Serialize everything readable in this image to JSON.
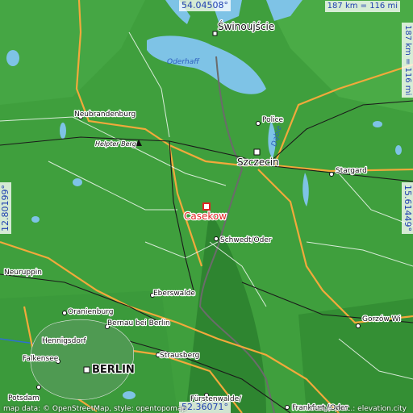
{
  "coordinates": {
    "lat_top": "54.04508°",
    "lat_bottom": "52.36071°",
    "lon_left": "12.80199°",
    "lon_right": "15.61449°"
  },
  "scale": {
    "horizontal": "187 km = 116 mi",
    "vertical": "187 km = 116 mi"
  },
  "target_place": "Casekow",
  "places": {
    "swinoujscie": "Świnoujście",
    "police": "Police",
    "szczecin": "Szczecin",
    "stargard": "Stargard",
    "neubrandenburg": "Neubrandenburg",
    "helpter_berg": "Helpter Berg",
    "schwedt": "Schwedt/Oder",
    "neuruppin": "Neuruppin",
    "eberswalde": "Eberswalde",
    "oranienburg": "Oranienburg",
    "bernau": "Bernau bei Berlin",
    "hennigsdorf": "Hennigsdorf",
    "falkensee": "Falkensee",
    "berlin": "BERLIN",
    "strausberg": "Strausberg",
    "potsdam": "Potsdam",
    "gorzow": "Gorzów Wi",
    "furstenwalde": "Fürstenwalde/",
    "frankfurt": "Frankfurt (Oder"
  },
  "water_labels": {
    "oderhaff": "Oderhaff",
    "dabie": "Dąbie"
  },
  "footer": {
    "left": "map data: © OpenStreetMap, style: opentopomap",
    "right": "image proc.: elevation.city"
  },
  "colors": {
    "land": "#3a9a3a",
    "lowland": "#2f8a32",
    "water": "#7ec3e6",
    "coordinate_text": "#1e3fb0",
    "target_text": "#e02424",
    "road_major": "#f2a93b",
    "road_minor": "#ffffff"
  }
}
